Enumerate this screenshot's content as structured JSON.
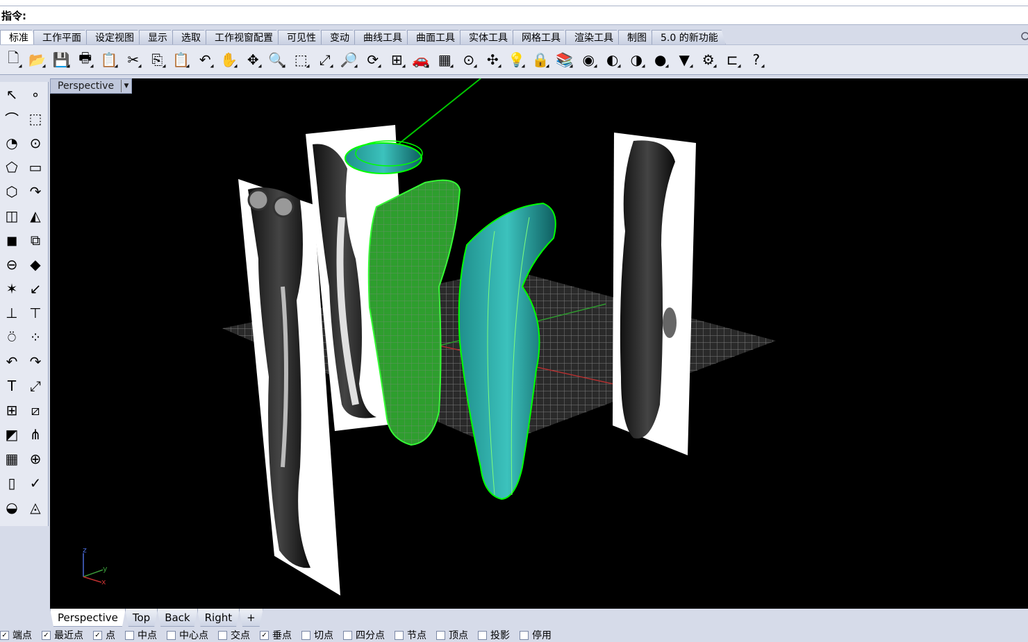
{
  "command": {
    "label": "指令:"
  },
  "ribbon_tabs": [
    "标准",
    "工作平面",
    "设定视图",
    "显示",
    "选取",
    "工作视窗配置",
    "可见性",
    "变动",
    "曲线工具",
    "曲面工具",
    "实体工具",
    "网格工具",
    "渲染工具",
    "制图",
    "5.0 的新功能"
  ],
  "toolbar_icons": [
    "new-file-icon",
    "open-folder-icon",
    "save-icon",
    "print-icon",
    "import-icon",
    "cut-icon",
    "copy-icon",
    "paste-icon",
    "undo-icon",
    "pan-hand-icon",
    "rotate-view-icon",
    "zoom-icon",
    "zoom-window-icon",
    "zoom-extents-icon",
    "zoom-selected-icon",
    "rotate-icon",
    "four-view-icon",
    "car-icon",
    "grid-icon",
    "snap-icon",
    "point-icon",
    "light-icon",
    "lock-icon",
    "layer-icon",
    "color-wheel-icon",
    "shade-icon",
    "render-sphere-icon",
    "material-icon",
    "cone-icon",
    "settings-icon",
    "dimension-icon",
    "help-icon"
  ],
  "toolbar_glyphs": [
    "🗋",
    "📂",
    "💾",
    "🖶",
    "📋",
    "✂",
    "⎘",
    "📋",
    "↶",
    "✋",
    "✥",
    "🔍",
    "⬚",
    "⤢",
    "🔎",
    "⟳",
    "⊞",
    "🚗",
    "▦",
    "⊙",
    "✣",
    "💡",
    "🔒",
    "📚",
    "◉",
    "◐",
    "◑",
    "●",
    "▼",
    "⚙",
    "⊏",
    "?"
  ],
  "left_tools": [
    [
      "↖",
      "∘"
    ],
    [
      "⌒",
      "⬚"
    ],
    [
      "◔",
      "⊙"
    ],
    [
      "⬠",
      "▭"
    ],
    [
      "⬡",
      "↷"
    ],
    [
      "◫",
      "◭"
    ],
    [
      "◼",
      "⧉"
    ],
    [
      "⊖",
      "◆"
    ],
    [
      "✶",
      "↙"
    ],
    [
      "⊥",
      "⊤"
    ],
    [
      "⍥",
      "⁘"
    ],
    [
      "↶",
      "↷"
    ],
    [
      "T",
      "⤢"
    ],
    [
      "⊞",
      "⧄"
    ],
    [
      "◩",
      "⋔"
    ],
    [
      "▦",
      "⊕"
    ],
    [
      "▯",
      "✓"
    ],
    [
      "◒",
      "◬"
    ]
  ],
  "viewport": {
    "title": "Perspective"
  },
  "viewport_tabs": [
    "Perspective",
    "Top",
    "Back",
    "Right"
  ],
  "viewport_tab_add": "+",
  "axes": {
    "z": "z",
    "y": "y",
    "x": "x"
  },
  "snap_options": [
    {
      "label": "端点",
      "checked": true
    },
    {
      "label": "最近点",
      "checked": true
    },
    {
      "label": "点",
      "checked": true
    },
    {
      "label": "中点",
      "checked": false
    },
    {
      "label": "中心点",
      "checked": false
    },
    {
      "label": "交点",
      "checked": false
    },
    {
      "label": "垂点",
      "checked": true
    },
    {
      "label": "切点",
      "checked": false
    },
    {
      "label": "四分点",
      "checked": false
    },
    {
      "label": "节点",
      "checked": false
    },
    {
      "label": "顶点",
      "checked": false
    },
    {
      "label": "投影",
      "checked": false
    },
    {
      "label": "停用",
      "checked": false
    }
  ]
}
